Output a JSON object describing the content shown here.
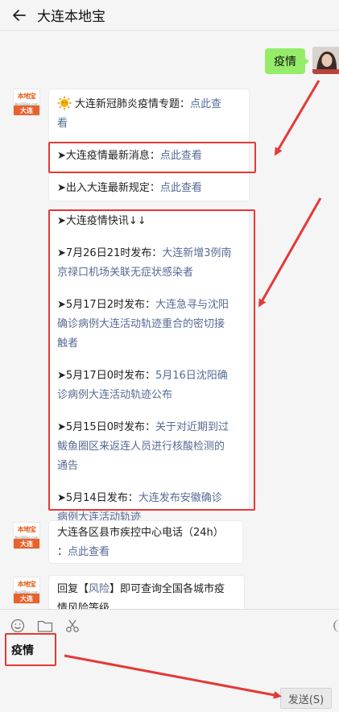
{
  "header": {
    "title": "大连本地宝"
  },
  "outgoing": {
    "text": "疫情"
  },
  "bot": {
    "logo_top": "本地宝",
    "logo_mid": "BenDiBao.com",
    "logo_bottom": "大连"
  },
  "reply1": {
    "topic_prefix": "大连新冠肺炎疫情专题：",
    "topic_link_a": "点此查",
    "topic_link_b": "看",
    "news_prefix": "➤大连疫情最新消息：",
    "news_link": "点此查看",
    "rules_prefix": "➤出入大连最新规定：",
    "rules_link": "点此查看",
    "flash_title": "➤大连疫情快讯↓↓",
    "items": [
      {
        "prefix": "➤7月26日21时发布：",
        "line1": "大连新增3例南",
        "line2": "京禄口机场关联无症状感染者",
        "line3": ""
      },
      {
        "prefix": "➤5月17日2时发布：",
        "line1": "大连急寻与沈阳",
        "line2": "确诊病例大连活动轨迹重合的密切接",
        "line3": "触者"
      },
      {
        "prefix": "➤5月17日0时发布：",
        "line1": "5月16日沈阳确",
        "line2": "诊病例大连活动轨迹公布",
        "line3": ""
      },
      {
        "prefix": "➤5月15日0时发布：",
        "line1": "关于对近期到过",
        "line2": "鲅鱼圈区来返连人员进行核酸检测的",
        "line3": "通告"
      },
      {
        "prefix": "➤5月14日发布：",
        "line1": "大连发布安徽确诊",
        "line2": "病例大连活动轨迹",
        "line3": ""
      }
    ]
  },
  "reply2": {
    "line1": "大连各区县市疾控中心电话（24h）",
    "line2_prefix": "：",
    "line2_link": "点此查看"
  },
  "reply3": {
    "line1_prefix": "回复【",
    "line1_link": "风险",
    "line1_suffix": "】即可查询全国各城市疫",
    "line2": "情风险等级"
  },
  "input": {
    "text": "疫情"
  },
  "send": {
    "label": "发送(S)"
  },
  "colors": {
    "link": "#576b95",
    "bubble_out": "#95ec69",
    "highlight": "#e53935"
  }
}
